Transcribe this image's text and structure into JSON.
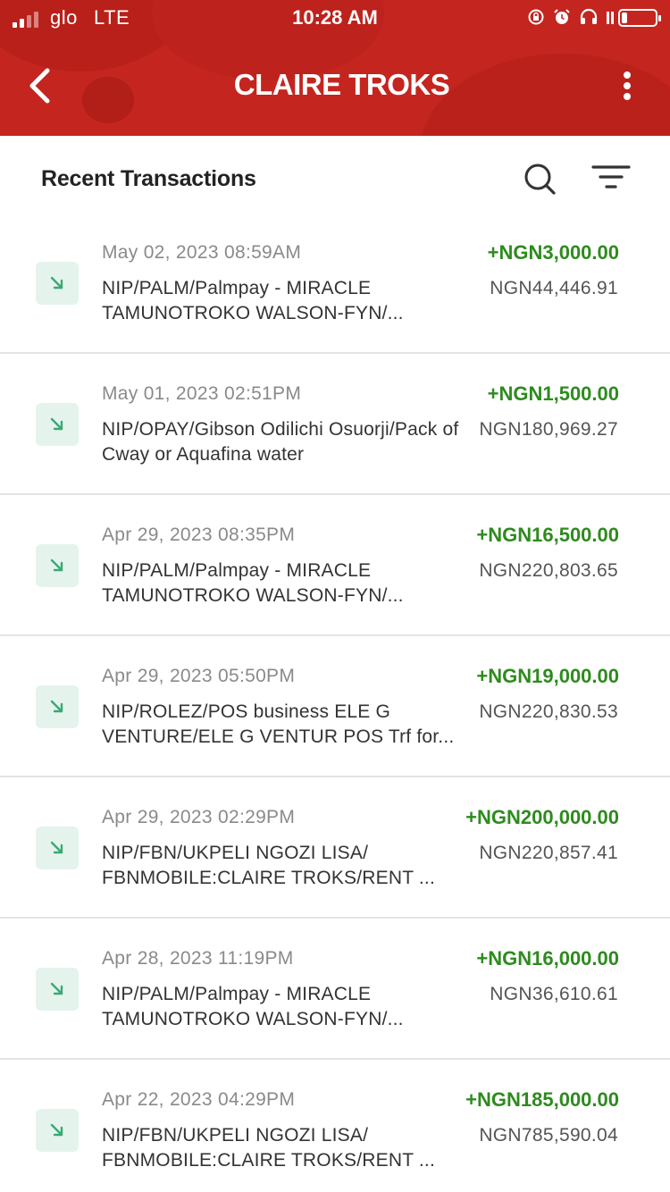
{
  "status_bar": {
    "carrier": "glo",
    "network": "LTE",
    "time": "10:28 AM",
    "icons": [
      "rotation-lock-icon",
      "alarm-icon",
      "headphones-icon",
      "battery-icon"
    ]
  },
  "header": {
    "title": "CLAIRE TROKS",
    "back_icon": "chevron-left-icon",
    "menu_icon": "more-vertical-icon",
    "background_color": "#c4251f"
  },
  "section": {
    "title": "Recent Transactions",
    "search_icon": "search-icon",
    "filter_icon": "filter-icon"
  },
  "colors": {
    "credit_amount": "#2e8b1e",
    "icon_bg": "#e4f4ec",
    "icon_arrow": "#3aa876"
  },
  "transactions": [
    {
      "date": "May 02, 2023 08:59AM",
      "description": "NIP/PALM/Palmpay - MIRACLE TAMUNOTROKO WALSON-FYN/...",
      "amount": "+NGN3,000.00",
      "balance": "NGN44,446.91",
      "icon": "arrow-down-right-icon"
    },
    {
      "date": "May 01, 2023 02:51PM",
      "description": "NIP/OPAY/Gibson Odilichi Osuorji/Pack of Cway or Aquafina water",
      "amount": "+NGN1,500.00",
      "balance": "NGN180,969.27",
      "icon": "arrow-down-right-icon"
    },
    {
      "date": "Apr 29, 2023 08:35PM",
      "description": "NIP/PALM/Palmpay - MIRACLE TAMUNOTROKO WALSON-FYN/...",
      "amount": "+NGN16,500.00",
      "balance": "NGN220,803.65",
      "icon": "arrow-down-right-icon"
    },
    {
      "date": "Apr 29, 2023 05:50PM",
      "description": "NIP/ROLEZ/POS business ELE G VENTURE/ELE G VENTUR POS Trf for...",
      "amount": "+NGN19,000.00",
      "balance": "NGN220,830.53",
      "icon": "arrow-down-right-icon"
    },
    {
      "date": "Apr 29, 2023 02:29PM",
      "description": "NIP/FBN/UKPELI NGOZI LISA/ FBNMOBILE:CLAIRE TROKS/RENT ...",
      "amount": "+NGN200,000.00",
      "balance": "NGN220,857.41",
      "icon": "arrow-down-right-icon"
    },
    {
      "date": "Apr 28, 2023 11:19PM",
      "description": "NIP/PALM/Palmpay - MIRACLE TAMUNOTROKO WALSON-FYN/...",
      "amount": "+NGN16,000.00",
      "balance": "NGN36,610.61",
      "icon": "arrow-down-right-icon"
    },
    {
      "date": "Apr 22, 2023 04:29PM",
      "description": "NIP/FBN/UKPELI NGOZI LISA/ FBNMOBILE:CLAIRE TROKS/RENT ...",
      "amount": "+NGN185,000.00",
      "balance": "NGN785,590.04",
      "icon": "arrow-down-right-icon"
    }
  ]
}
